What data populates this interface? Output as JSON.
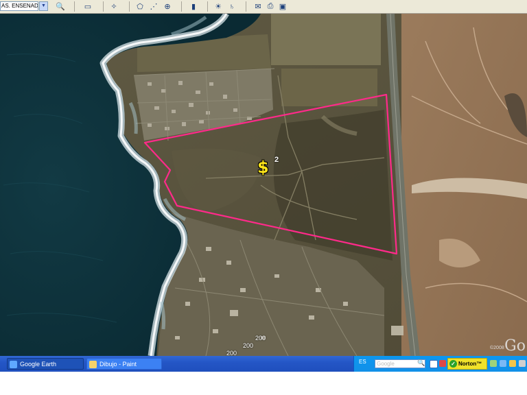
{
  "toolbar": {
    "search_value": "AS. ENSENADA.",
    "buttons": [
      {
        "name": "search-icon",
        "glyph": "🔍"
      },
      {
        "name": "sidebar-toggle-icon",
        "glyph": "▭"
      },
      {
        "name": "placemark-add-icon",
        "glyph": "✧"
      },
      {
        "name": "polygon-add-icon",
        "glyph": "⬠"
      },
      {
        "name": "path-add-icon",
        "glyph": "⋰"
      },
      {
        "name": "overlay-add-icon",
        "glyph": "⊕"
      },
      {
        "name": "ruler-icon",
        "glyph": "▮"
      },
      {
        "name": "sun-icon",
        "glyph": "☀"
      },
      {
        "name": "planet-icon",
        "glyph": "♄"
      },
      {
        "name": "email-icon",
        "glyph": "✉"
      },
      {
        "name": "print-icon",
        "glyph": "⎙"
      },
      {
        "name": "save-image-icon",
        "glyph": "▣"
      }
    ]
  },
  "map": {
    "placemark": {
      "icon": "dollar-sign-icon",
      "symbol": "$",
      "label": "2",
      "color": "#ffe51a"
    },
    "polygon_color": "#ff2a8a",
    "elevation_labels": [
      "200",
      "200",
      "200"
    ],
    "copyright": "©2008",
    "logo": "Go"
  },
  "taskbar": {
    "tasks": [
      {
        "label": "Google Earth",
        "state": "active"
      },
      {
        "label": "Dibujo - Paint",
        "state": "normal"
      }
    ],
    "language": "ES",
    "search_placeholder": "Google",
    "norton_label": "Norton™"
  }
}
